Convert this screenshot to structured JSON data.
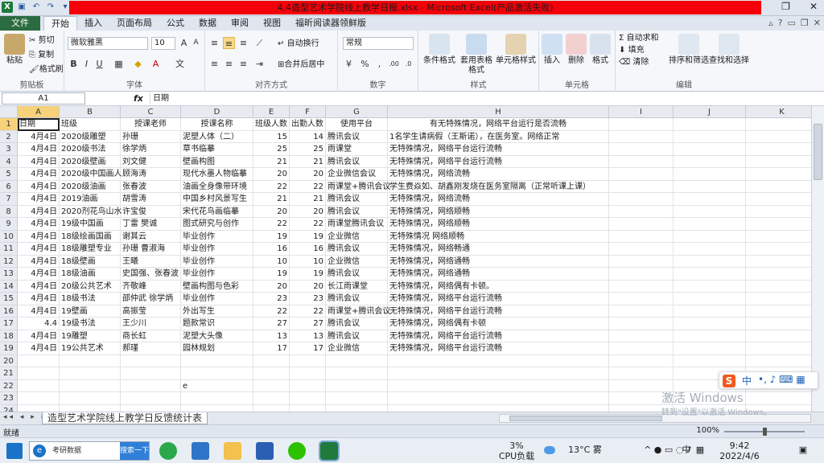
{
  "window": {
    "title": "4.4造型艺术学院线上教学日报.xlsx - Microsoft Excel(产品激活失败)"
  },
  "tabs": [
    "文件",
    "开始",
    "插入",
    "页面布局",
    "公式",
    "数据",
    "审阅",
    "视图",
    "福昕阅读器领鲜版"
  ],
  "ribbon": {
    "clipboard": {
      "label": "剪贴板",
      "paste": "粘贴",
      "cut": "剪切",
      "copy": "复制",
      "format_painter": "格式刷"
    },
    "font": {
      "label": "字体",
      "name": "微软雅黑",
      "size": "10"
    },
    "alignment": {
      "label": "对齐方式",
      "wrap": "自动换行",
      "merge": "合并后居中"
    },
    "number": {
      "label": "数字",
      "format": "常规"
    },
    "styles": {
      "label": "样式",
      "cond": "条件格式",
      "table": "套用表格格式",
      "cellstyle": "单元格样式"
    },
    "cells": {
      "label": "单元格",
      "insert": "插入",
      "delete": "删除",
      "format": "格式"
    },
    "editing": {
      "label": "编辑",
      "autosum": "自动求和",
      "fill": "填充",
      "clear": "清除",
      "sort": "排序和筛选",
      "find": "查找和选择"
    }
  },
  "formula_bar": {
    "name_box": "A1",
    "fx": "fx",
    "value": "日期"
  },
  "columns": [
    "A",
    "B",
    "C",
    "D",
    "E",
    "F",
    "G",
    "H",
    "I",
    "J",
    "K"
  ],
  "rows": [
    [
      "日期",
      "班级",
      "授课老师",
      "授课名称",
      "班级人数",
      "出勤人数",
      "使用平台",
      "有无特殊情况，网络平台运行是否流畅"
    ],
    [
      "4月4日",
      "2020级雕塑",
      "孙珊",
      "泥塑人体（二）",
      "15",
      "14",
      "腾讯会议",
      "1名学生请病假（王斯诺），在医务室。网络正常"
    ],
    [
      "4月4日",
      "2020级书法",
      "徐学炳",
      "草书临摹",
      "25",
      "25",
      "雨课堂",
      "无特殊情况，网络平台运行流畅"
    ],
    [
      "4月4日",
      "2020级壁画",
      "刘文健",
      "壁画构图",
      "21",
      "21",
      "腾讯会议",
      "无特殊情况，网络平台运行流畅"
    ],
    [
      "4月4日",
      "2020级中国画人",
      "顾海涛",
      "现代水墨人物临摹",
      "20",
      "20",
      "企业微信会议",
      "无特殊情况，网络流畅"
    ],
    [
      "4月4日",
      "2020级油画",
      "张春波",
      "油画全身像带环境",
      "22",
      "22",
      "雨课堂+腾讯会议",
      "学生费焱如、胡鑫刚发烧在医务室隔离（正常听课上课）"
    ],
    [
      "4月4日",
      "2019油画",
      "胡雪涛",
      "中国乡村风景写生",
      "21",
      "21",
      "腾讯会议",
      "无特殊情况，网络流畅"
    ],
    [
      "4月4日",
      "2020剂花鸟山水",
      "许宝俊",
      "宋代花鸟画临摹",
      "20",
      "20",
      "腾讯会议",
      "无特殊情况，网络顺畅"
    ],
    [
      "4月4日",
      "19级中国画",
      "丁雷 樊诚",
      "图式研究与创作",
      "22",
      "22",
      "雨课堂腾讯会议",
      "无特殊情况，网络顺畅"
    ],
    [
      "4月4日",
      "18级绘画国画",
      "谢其云",
      "毕业创作",
      "19",
      "19",
      "企业微信",
      "无特殊情况 网络顺畅"
    ],
    [
      "4月4日",
      "18级雕塑专业",
      "孙珊 曹淑海",
      "毕业创作",
      "16",
      "16",
      "腾讯会议",
      "无特殊情况，网络畅通"
    ],
    [
      "4月4日",
      "18级壁画",
      "王曦",
      "毕业创作",
      "10",
      "10",
      "企业微信",
      "无特殊情况，网络通畅"
    ],
    [
      "4月4日",
      "18级油画",
      "史国强、张春波",
      "毕业创作",
      "19",
      "19",
      "腾讯会议",
      "无特殊情况，网络通畅"
    ],
    [
      "4月4日",
      "20级公共艺术",
      "齐敬峰",
      "壁画构图与色彩",
      "20",
      "20",
      "长江雨课堂",
      "无特殊情况，网络偶有卡顿。"
    ],
    [
      "4月4日",
      "18级书法",
      "邵仲武 徐学炳",
      "毕业创作",
      "23",
      "23",
      "腾讯会议",
      "无特殊情况，网络平台运行流畅"
    ],
    [
      "4月4日",
      "19壁画",
      "高振莹",
      "外出写生",
      "22",
      "22",
      "雨课堂+腾讯会议",
      "无特殊情况，网络平台运行流畅"
    ],
    [
      "4.4",
      "19级书法",
      "王少川",
      "题款常识",
      "27",
      "27",
      "腾讯会议",
      "无特殊情况，网络偶有卡顿"
    ],
    [
      "4月4日",
      "19雕塑",
      "商长虹",
      "泥塑大头像",
      "13",
      "13",
      "腾讯会议",
      "无特殊情况，网络平台运行流畅"
    ],
    [
      "4月4日",
      "19公共艺术",
      "郝瑾",
      "园林规划",
      "17",
      "17",
      "企业微信",
      "无特殊情况，网络平台运行流畅"
    ],
    [
      "",
      "",
      "",
      "",
      "",
      "",
      "",
      ""
    ],
    [
      "",
      "",
      "",
      "",
      "",
      "",
      "",
      ""
    ],
    [
      "",
      "",
      "",
      "e",
      "",
      "",
      "",
      ""
    ],
    [
      "",
      "",
      "",
      "",
      "",
      "",
      "",
      ""
    ],
    [
      "",
      "",
      "",
      "",
      "",
      "",
      "",
      ""
    ]
  ],
  "sheet_tab": "造型艺术学院线上教学日反馈统计表",
  "status": {
    "ready": "就绪",
    "zoom": "100%"
  },
  "taskbar": {
    "search_text": "考研数据",
    "search_btn": "搜索一下",
    "cpu_pct": "3%",
    "cpu_label": "CPU负载",
    "weather": "13°C 雾",
    "ime": "中",
    "time": "9:42",
    "date": "2022/4/6"
  },
  "activation": {
    "line1": "激活 Windows",
    "line2": "转到\"设置\"以激活 Windows。"
  }
}
